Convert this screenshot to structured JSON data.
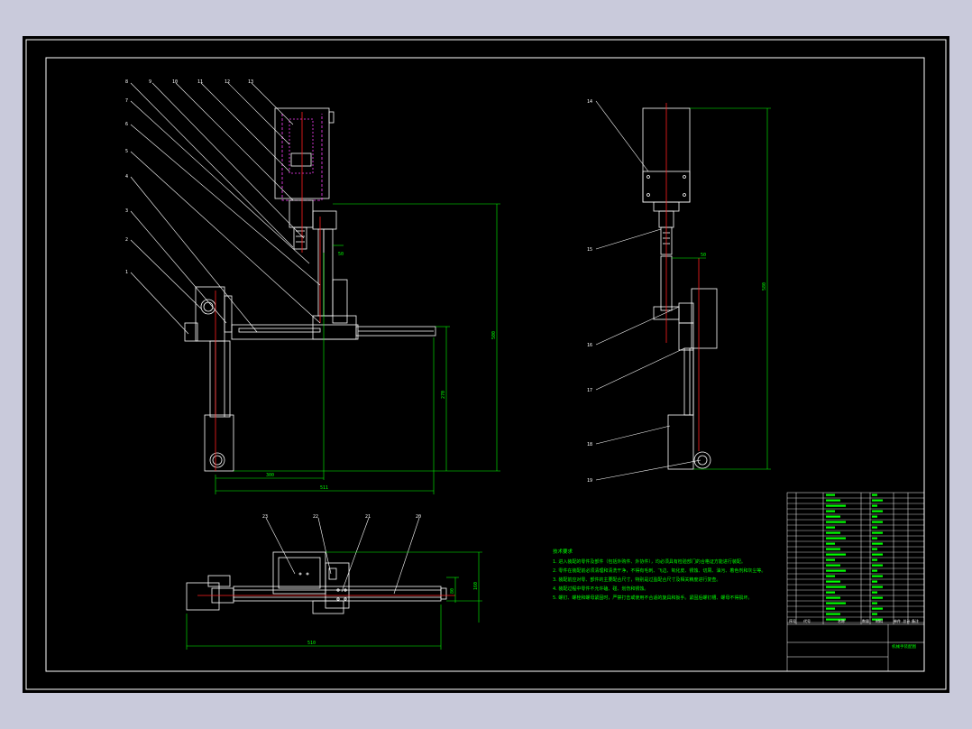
{
  "colors": {
    "background": "#c9cadb",
    "sheet": "#000000",
    "frame": "#ffffff",
    "dimension": "#00ff00",
    "centerline": "#ff2020",
    "hidden": "#ff40ff",
    "text": "#ffffff"
  },
  "front_view": {
    "part_labels": [
      "8",
      "9",
      "10",
      "11",
      "12",
      "13",
      "7",
      "6",
      "5",
      "4",
      "3",
      "2",
      "1"
    ],
    "dims": {
      "vertical_total": "500",
      "vertical_mid": "270",
      "horizontal_inner": "300",
      "horizontal_outer": "511",
      "small_top": "50"
    }
  },
  "side_view": {
    "part_labels": [
      "14",
      "15",
      "16",
      "17",
      "18",
      "19"
    ],
    "dims": {
      "height": "580",
      "small": "50"
    }
  },
  "top_view": {
    "part_labels": [
      "23",
      "22",
      "21",
      "20"
    ],
    "dims": {
      "width": "510",
      "height_small": "80",
      "height_big": "160"
    }
  },
  "tech_notes": {
    "title": "技术要求",
    "items": [
      "1. 进入装配的零件及部件（包括外购件、外协件），均必须具有检验部门的合格证方能进行装配。",
      "2. 零件在装配前必须清理和清洗干净，不得有毛刺、飞边、氧化皮、锈蚀、切屑、油污、着色剂和灰尘等。",
      "3. 装配前应对零、部件的主要配合尺寸，特别是过盈配合尺寸及相关精度进行复查。",
      "4. 装配过程中零件不允许磕、碰、划伤和锈蚀。",
      "5. 螺钉、螺栓和螺母紧固时，严禁打击或使用不合适的旋具和扳手。紧固后螺钉槽、螺母不得损坏。"
    ]
  },
  "title_block": {
    "drawing_title": "机械手装配图",
    "header_cols": [
      "序号",
      "代号",
      "名称",
      "数量",
      "材料",
      "单件 总计",
      "备注"
    ]
  }
}
